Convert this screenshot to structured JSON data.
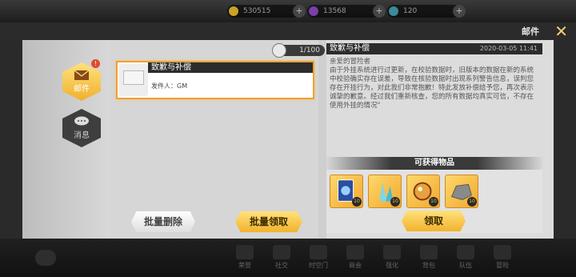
{
  "topbar": {
    "resources": [
      {
        "value": "530515",
        "icon": "gold-coin-icon",
        "color": "#c9a227"
      },
      {
        "value": "13568",
        "icon": "purple-gem-icon",
        "color": "#7a3fa8"
      },
      {
        "value": "120",
        "icon": "stamina-icon",
        "color": "#3a8a9a"
      }
    ],
    "plus_symbol": "+"
  },
  "header": {
    "title": "邮件",
    "close_symbol": "✕"
  },
  "sidebar": {
    "tabs": [
      {
        "label": "邮件",
        "icon": "envelope-icon",
        "active": true,
        "badge": "!"
      },
      {
        "label": "消息",
        "icon": "chat-bubble-icon",
        "active": false
      }
    ]
  },
  "maillist": {
    "count": "1/100",
    "items": [
      {
        "title": "致歉与补偿",
        "sender": "发件人：GM"
      }
    ],
    "batch_delete": "批量删除",
    "batch_claim": "批量领取"
  },
  "detail": {
    "title": "致歉与补偿",
    "date": "2020-03-05  11:41",
    "body": "亲爱的冒险者\n由于外挂系统进行过更新，在校验数据时，旧版本的数据在新的系统中校验确实存在误差，导致在核验数据时出现系列警告信息，误判您存在开挂行为，对此我们非常抱歉！特此发放补偿给予您，再次表示诚挚的歉意。经过我们重新核查，您的所有数据均真实可信，不存在使用外挂的情况\"",
    "rewards_title": "可获得物品",
    "rewards": [
      {
        "icon": "card-pack-icon",
        "level": "10"
      },
      {
        "icon": "crystal-shard-icon",
        "level": "10"
      },
      {
        "icon": "orb-icon",
        "level": "10"
      },
      {
        "icon": "ore-chunk-icon",
        "level": "10"
      }
    ],
    "claim_label": "领取"
  },
  "bottom_nav": [
    {
      "label": "荣誉"
    },
    {
      "label": "社交"
    },
    {
      "label": "时空门"
    },
    {
      "label": "商会"
    },
    {
      "label": "强化"
    },
    {
      "label": "背包"
    },
    {
      "label": "队伍"
    },
    {
      "label": "冒险"
    }
  ]
}
